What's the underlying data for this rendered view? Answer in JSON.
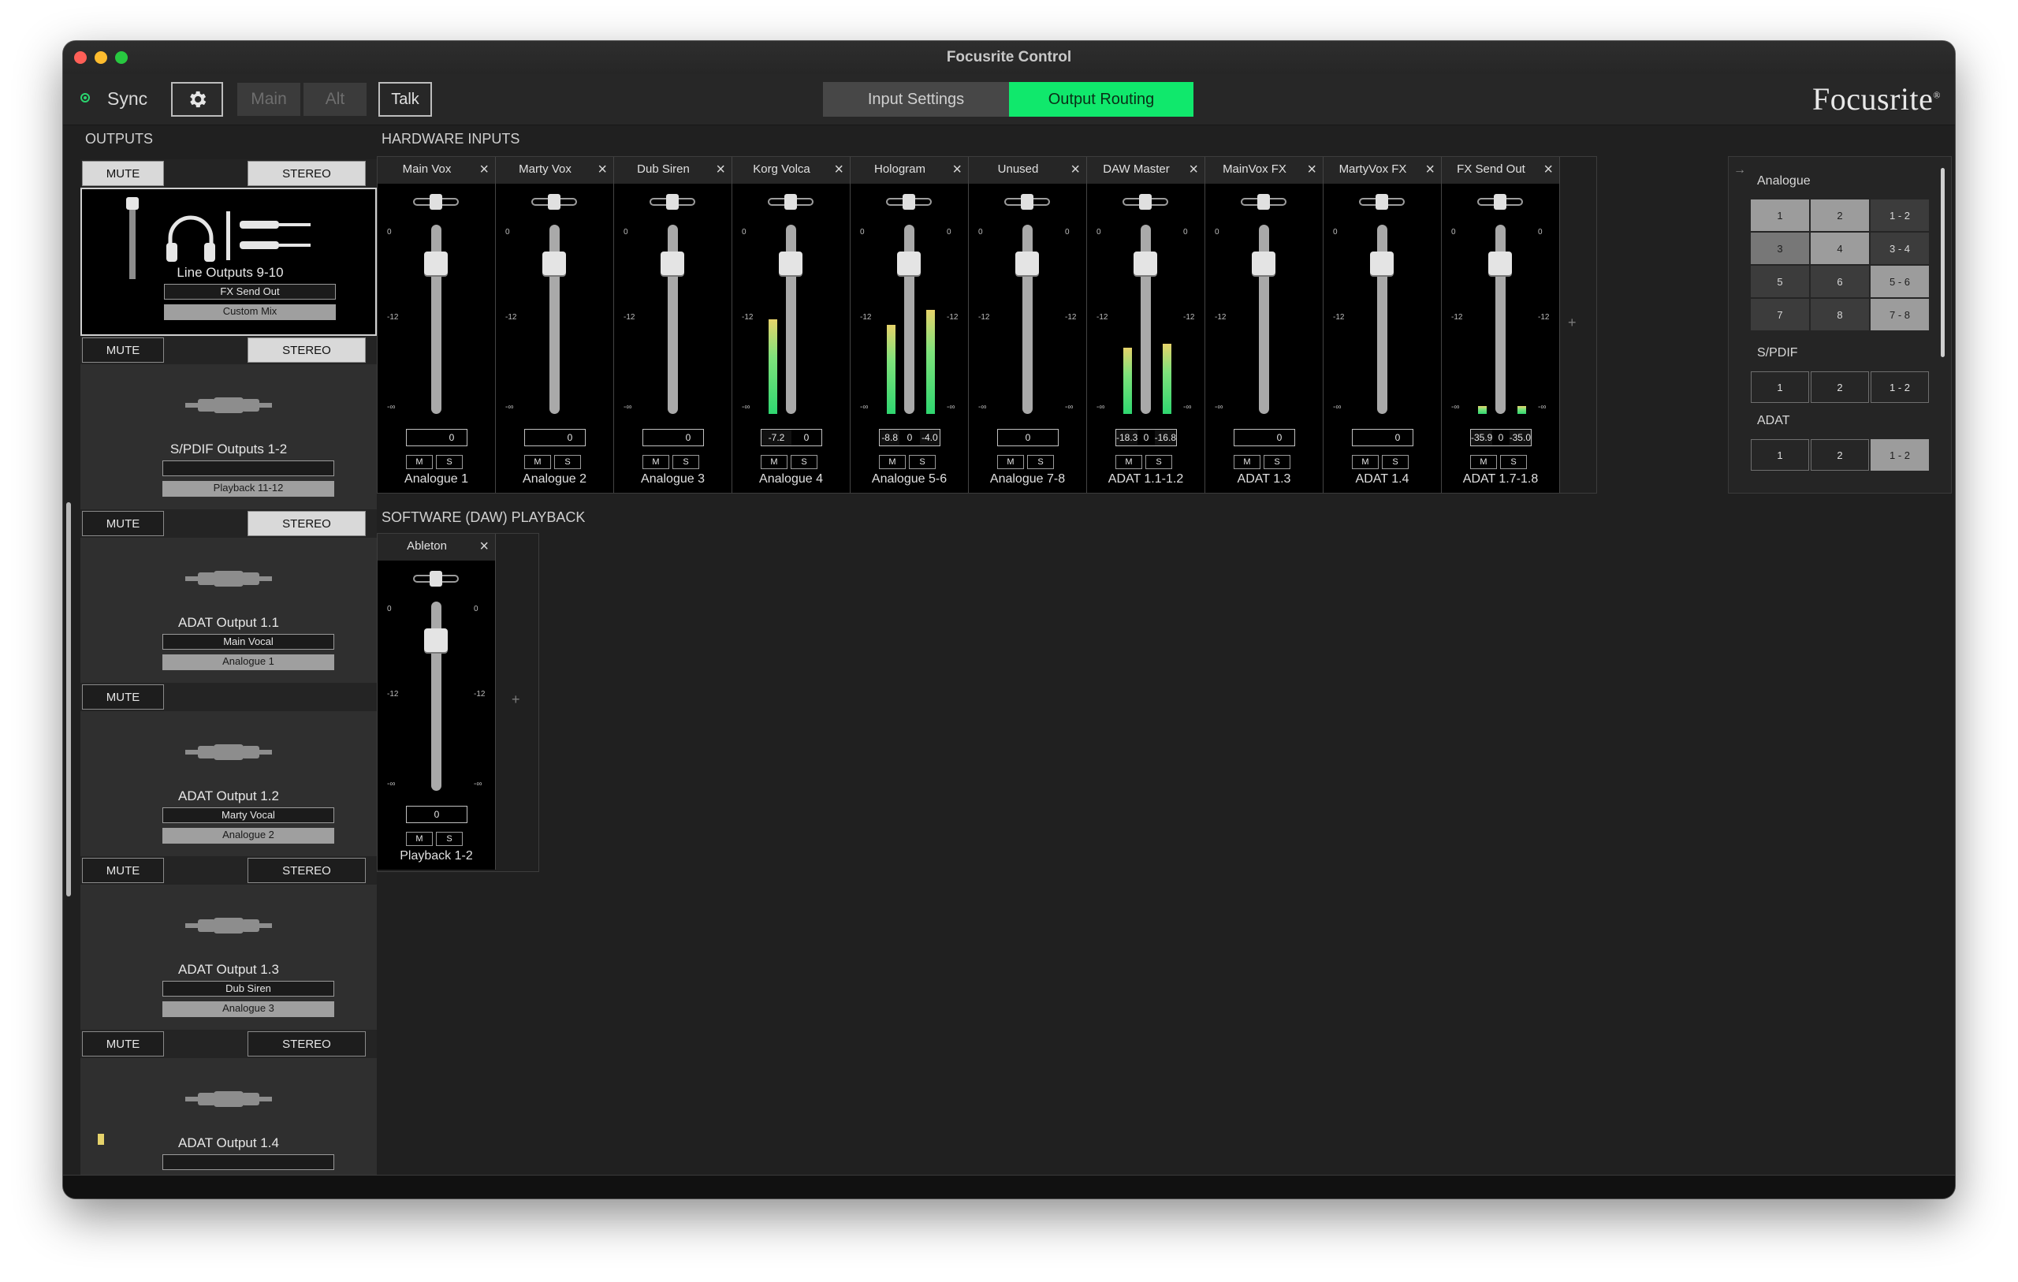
{
  "window": {
    "title": "Focusrite Control"
  },
  "toolbar": {
    "sync_label": "Sync",
    "main_label": "Main",
    "alt_label": "Alt",
    "talk_label": "Talk",
    "tabs": [
      "Input Settings",
      "Output Routing"
    ],
    "active_tab": "Output Routing",
    "brand": "Focusrite",
    "brand_mark": "®",
    "accent_color": "#10e86c"
  },
  "outputs": {
    "heading": "OUTPUTS",
    "mute_label": "MUTE",
    "stereo_label": "STEREO",
    "cards": [
      {
        "name": "Line Outputs 9-10",
        "mix_name": "FX Send Out",
        "source": "Custom Mix",
        "icon": "headphones-icon"
      },
      {
        "name": "S/PDIF Outputs 1-2",
        "mix_name": "",
        "source": "Playback 11-12",
        "icon": "cable-icon"
      },
      {
        "name": "ADAT Output 1.1",
        "mix_name": "Main Vocal",
        "source": "Analogue 1",
        "icon": "cable-icon"
      },
      {
        "name": "ADAT Output 1.2",
        "mix_name": "Marty Vocal",
        "source": "Analogue 2",
        "icon": "cable-icon"
      },
      {
        "name": "ADAT Output 1.3",
        "mix_name": "Dub Siren",
        "source": "Analogue 3",
        "icon": "cable-icon"
      },
      {
        "name": "ADAT Output 1.4",
        "mix_name": "",
        "source": "",
        "icon": "cable-icon"
      }
    ]
  },
  "hardware_inputs": {
    "heading": "HARDWARE INPUTS",
    "add_label": "+",
    "scale": {
      "top": "0",
      "mid": "-12",
      "bottom": "-∞"
    },
    "mute_btn": "M",
    "solo_btn": "S",
    "strips": [
      {
        "name": "Main Vox",
        "source": "Analogue 1",
        "gain": [
          "",
          "0"
        ],
        "stereo": false,
        "meter": [
          0
        ]
      },
      {
        "name": "Marty Vox",
        "source": "Analogue 2",
        "gain": [
          "",
          "0"
        ],
        "stereo": false,
        "meter": [
          0
        ]
      },
      {
        "name": "Dub Siren",
        "source": "Analogue 3",
        "gain": [
          "",
          "0"
        ],
        "stereo": false,
        "meter": [
          0
        ]
      },
      {
        "name": "Korg Volca",
        "source": "Analogue 4",
        "gain": [
          "-7.2",
          "0"
        ],
        "stereo": false,
        "meter": [
          0.5
        ]
      },
      {
        "name": "Hologram",
        "source": "Analogue 5-6",
        "gain": [
          "-8.8",
          "0",
          "-4.0"
        ],
        "stereo": true,
        "meter": [
          0.47,
          0.55
        ]
      },
      {
        "name": "Unused",
        "source": "Analogue 7-8",
        "gain": [
          "",
          "0",
          ""
        ],
        "stereo": true,
        "meter": [
          0,
          0
        ]
      },
      {
        "name": "DAW Master",
        "source": "ADAT 1.1-1.2",
        "gain": [
          "-18.3",
          "0",
          "-16.8"
        ],
        "stereo": true,
        "meter": [
          0.35,
          0.37
        ]
      },
      {
        "name": "MainVox FX",
        "source": "ADAT 1.3",
        "gain": [
          "",
          "0"
        ],
        "stereo": false,
        "meter": [
          0
        ]
      },
      {
        "name": "MartyVox FX",
        "source": "ADAT 1.4",
        "gain": [
          "",
          "0"
        ],
        "stereo": false,
        "meter": [
          0
        ]
      },
      {
        "name": "FX Send Out",
        "source": "ADAT 1.7-1.8",
        "gain": [
          "-35.9",
          "0",
          "-35.0"
        ],
        "stereo": true,
        "meter": [
          0.04,
          0.04
        ]
      }
    ]
  },
  "daw_playback": {
    "heading": "SOFTWARE (DAW) PLAYBACK",
    "add_label": "+",
    "strips": [
      {
        "name": "Ableton",
        "source": "Playback 1-2",
        "gain": [
          "",
          "0",
          ""
        ],
        "stereo": true,
        "meter": [
          0,
          0
        ]
      }
    ]
  },
  "routing": {
    "groups": [
      {
        "label": "Analogue",
        "rows": [
          [
            "1",
            "2",
            "1 - 2"
          ],
          [
            "3",
            "4",
            "3 - 4"
          ],
          [
            "5",
            "6",
            "5 - 6"
          ],
          [
            "7",
            "8",
            "7 - 8"
          ]
        ]
      },
      {
        "label": "S/PDIF",
        "rows": [
          [
            "1",
            "2",
            "1 - 2"
          ]
        ]
      },
      {
        "label": "ADAT",
        "rows": [
          [
            "1",
            "2",
            "1 - 2"
          ]
        ]
      }
    ]
  }
}
